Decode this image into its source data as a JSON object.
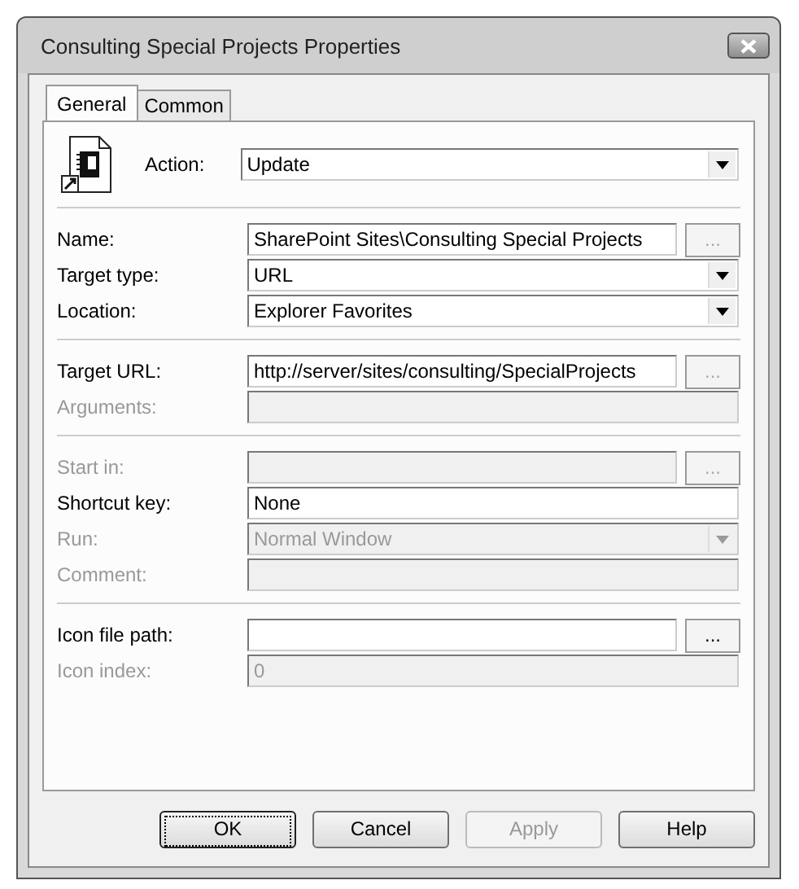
{
  "window": {
    "title": "Consulting Special Projects Properties"
  },
  "tabs": [
    {
      "label": "General",
      "selected": true
    },
    {
      "label": "Common",
      "selected": false
    }
  ],
  "action": {
    "label": "Action:",
    "value": "Update"
  },
  "sections": [
    {
      "rows": [
        {
          "label": "Name:",
          "kind": "text",
          "value": "SharePoint Sites\\Consulting Special Projects",
          "disabled": false,
          "browse": {
            "label": "...",
            "disabled": true
          }
        },
        {
          "label": "Target type:",
          "kind": "select",
          "value": "URL",
          "disabled": false
        },
        {
          "label": "Location:",
          "kind": "select",
          "value": "Explorer Favorites",
          "disabled": false
        }
      ]
    },
    {
      "rows": [
        {
          "label": "Target URL:",
          "kind": "text",
          "value": "http://server/sites/consulting/SpecialProjects",
          "disabled": false,
          "browse": {
            "label": "...",
            "disabled": true
          }
        },
        {
          "label": "Arguments:",
          "kind": "text",
          "disabled": true
        }
      ]
    },
    {
      "rows": [
        {
          "label": "Start in:",
          "kind": "text",
          "disabled": true,
          "browse": {
            "label": "...",
            "disabled": true
          }
        },
        {
          "label": "Shortcut key:",
          "kind": "text",
          "value": "None",
          "disabled": false
        },
        {
          "label": "Run:",
          "kind": "select",
          "value": "Normal Window",
          "disabled": true
        },
        {
          "label": "Comment:",
          "kind": "text",
          "disabled": true
        }
      ]
    },
    {
      "rows": [
        {
          "label": "Icon file path:",
          "kind": "text",
          "disabled": false,
          "browse": {
            "label": "...",
            "disabled": false
          }
        },
        {
          "label": "Icon index:",
          "kind": "text",
          "value": "0",
          "disabled": true
        }
      ]
    }
  ],
  "buttons": [
    {
      "label": "OK",
      "focused": true,
      "disabled": false
    },
    {
      "label": "Cancel",
      "focused": false,
      "disabled": false
    },
    {
      "label": "Apply",
      "focused": false,
      "disabled": true
    },
    {
      "label": "Help",
      "focused": false,
      "disabled": false
    }
  ]
}
